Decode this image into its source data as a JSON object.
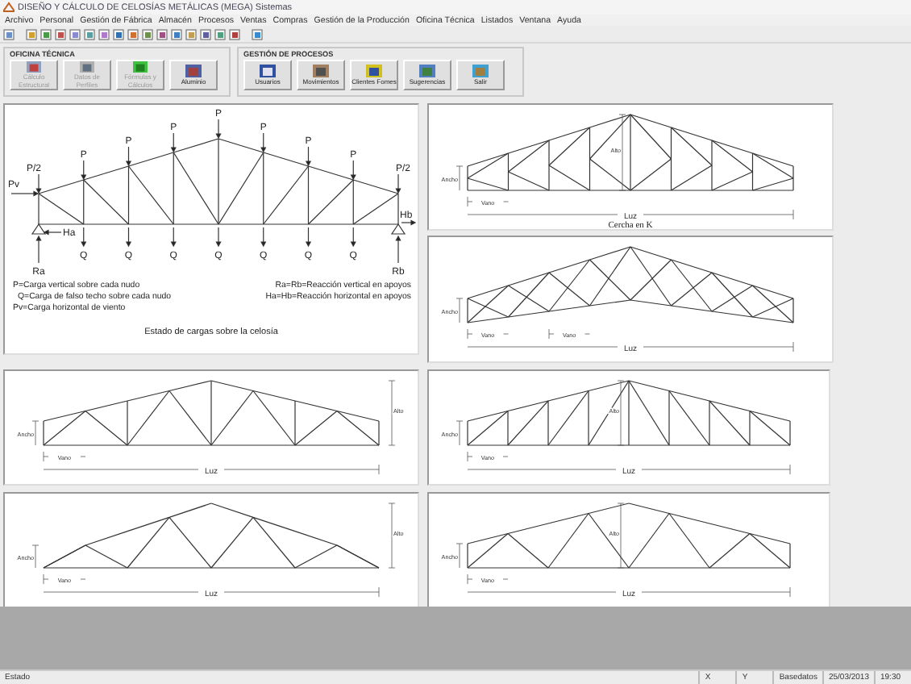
{
  "window": {
    "title": "DISEÑO Y CÁLCULO DE CELOSÍAS METÁLICAS (MEGA) Sistemas"
  },
  "menu": [
    "Archivo",
    "Personal",
    "Gestión de Fábrica",
    "Almacén",
    "Procesos",
    "Ventas",
    "Compras",
    "Gestión de la Producción",
    "Oficina Técnica",
    "Listados",
    "Ventana",
    "Ayuda"
  ],
  "button_groups": [
    {
      "title": "OFICINA TÉCNICA",
      "buttons": [
        {
          "label": "Cálculo Estructural",
          "disabled": true
        },
        {
          "label": "Datos de Perfiles",
          "disabled": true
        },
        {
          "label": "Fórmulas y Cálculos",
          "disabled": true
        },
        {
          "label": "Aluminio",
          "disabled": false
        }
      ]
    },
    {
      "title": "GESTIÓN DE PROCESOS",
      "buttons": [
        {
          "label": "Usuarios",
          "disabled": false
        },
        {
          "label": "Movimientos",
          "disabled": false
        },
        {
          "label": "Clientes Fomes",
          "disabled": false
        },
        {
          "label": "Sugerencias",
          "disabled": false
        },
        {
          "label": "Salir",
          "disabled": false
        }
      ]
    }
  ],
  "load_diagram": {
    "top_loads": [
      "P/2",
      "P",
      "P",
      "P",
      "P",
      "P",
      "P",
      "P",
      "P/2"
    ],
    "bottom_loads": [
      "Q",
      "Q",
      "Q",
      "Q",
      "Q",
      "Q",
      "Q"
    ],
    "wind": "Pv",
    "left_horizontal": "Ha",
    "right_horizontal": "Hb",
    "left_reaction": "Ra",
    "right_reaction": "Rb",
    "legend_left": [
      "P=Carga vertical sobre cada nudo",
      "Q=Carga de falso techo sobre cada nudo",
      "Pv=Carga horizontal de viento"
    ],
    "legend_right": [
      "Ra=Rb=Reacción vertical en apoyos",
      "Ha=Hb=Reacción horizontal en apoyos"
    ],
    "caption": "Estado de cargas sobre la celosía"
  },
  "trusses": [
    {
      "kind": "k-truss",
      "alto": "Alto",
      "ancho": "Ancho",
      "vano": [
        "Vano"
      ],
      "luz": "Luz",
      "caption": "Cercha en K"
    },
    {
      "kind": "lattice",
      "ancho": "Ancho",
      "vano": [
        "Vano",
        "Vano"
      ],
      "luz": "Luz"
    },
    {
      "kind": "warren-vertical",
      "alto": "Alto",
      "ancho": "Ancho",
      "vano": [
        "Vano"
      ],
      "luz": "Luz"
    },
    {
      "kind": "pratt",
      "alto": "Alto",
      "ancho": "Ancho",
      "vano": [
        "Vano"
      ],
      "luz": "Luz"
    },
    {
      "kind": "warren-trapezoid",
      "alto": "Alto",
      "ancho": "Ancho",
      "vano": [
        "Vano"
      ],
      "luz": "Luz"
    },
    {
      "kind": "warren",
      "alto": "Alto",
      "ancho": "Ancho",
      "vano": [
        "Vano"
      ],
      "luz": "Luz"
    }
  ],
  "status_bar": [
    "Estado",
    "X",
    "Y",
    "Basedatos",
    "25/03/2013",
    "19:30"
  ]
}
